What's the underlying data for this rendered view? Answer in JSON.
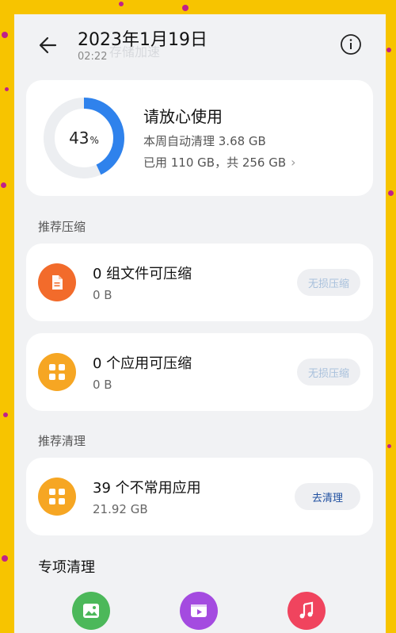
{
  "header": {
    "ghost_title": "存储加速",
    "date": "2023年1月19日",
    "time": "02:22"
  },
  "storage": {
    "percent_value": "43",
    "percent_unit": "%",
    "percent_fraction": 0.43,
    "title": "请放心使用",
    "auto_clean": "本周自动清理 3.68 GB",
    "used": "已用 110 GB，共 256 GB"
  },
  "compress": {
    "section_label": "推荐压缩",
    "items": [
      {
        "title": "0 组文件可压缩",
        "size": "0 B",
        "button": "无损压缩",
        "icon": "document-icon",
        "color": "#f26b2b"
      },
      {
        "title": "0 个应用可压缩",
        "size": "0 B",
        "button": "无损压缩",
        "icon": "apps-grid-icon",
        "color": "#f6a623"
      }
    ]
  },
  "clean": {
    "section_label": "推荐清理",
    "item": {
      "title": "39 个不常用应用",
      "size": "21.92 GB",
      "button": "去清理",
      "icon": "apps-grid-icon",
      "color": "#f6a623"
    }
  },
  "special": {
    "title": "专项清理",
    "icons": [
      {
        "name": "gallery-icon",
        "color": "#4cb85a"
      },
      {
        "name": "video-icon",
        "color": "#a44be0"
      },
      {
        "name": "music-icon",
        "color": "#f0445e"
      }
    ]
  },
  "colors": {
    "ring_accent": "#2f82ec",
    "ring_track": "#eceef1",
    "background": "#f7c400"
  }
}
